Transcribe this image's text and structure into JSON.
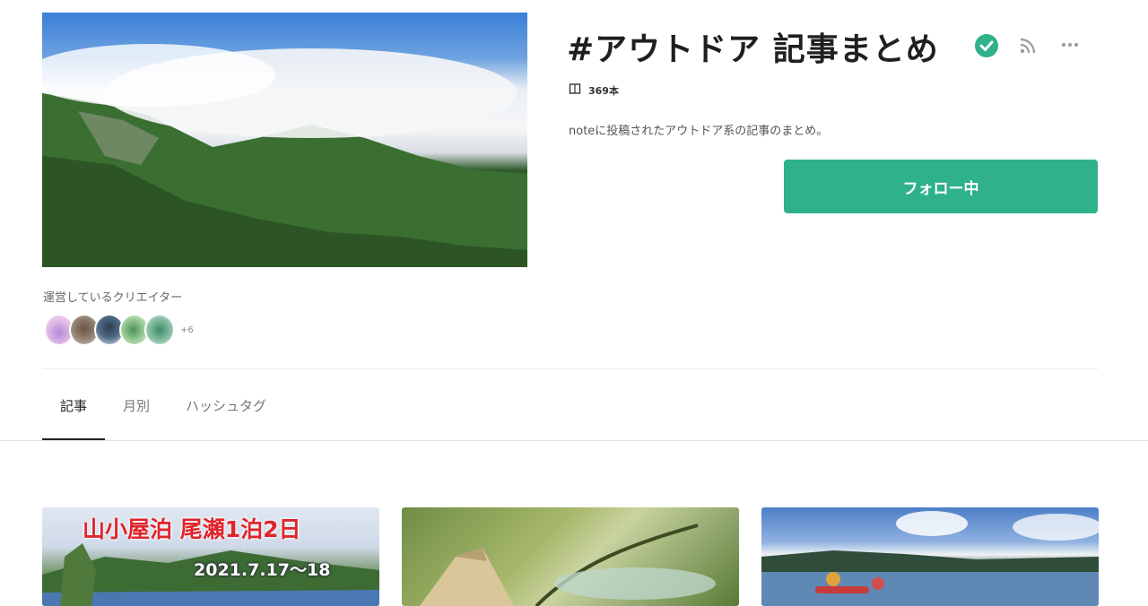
{
  "header": {
    "title": "#アウトドア 記事まとめ",
    "article_count": "369本",
    "description": "noteに投稿されたアウトドア系の記事のまとめ。",
    "follow_label": "フォロー中"
  },
  "creators": {
    "label": "運営しているクリエイター",
    "more_count": "+6",
    "avatars": [
      "avatar-1",
      "avatar-2",
      "avatar-3",
      "avatar-4",
      "avatar-5"
    ]
  },
  "tabs": [
    {
      "label": "記事",
      "active": true
    },
    {
      "label": "月別",
      "active": false
    },
    {
      "label": "ハッシュタグ",
      "active": false
    }
  ],
  "articles": [
    {
      "title": "山小屋泊 尾瀬1泊2日",
      "date": "2021.7.17〜18"
    },
    {
      "title": "",
      "date": ""
    },
    {
      "title": "",
      "date": ""
    }
  ],
  "icons": {
    "verified": "verified-check-icon",
    "rss": "rss-icon",
    "more": "more-horizontal-icon",
    "count": "book-icon"
  },
  "colors": {
    "accent": "#2fb18a",
    "card_title_red": "#e0242b"
  }
}
